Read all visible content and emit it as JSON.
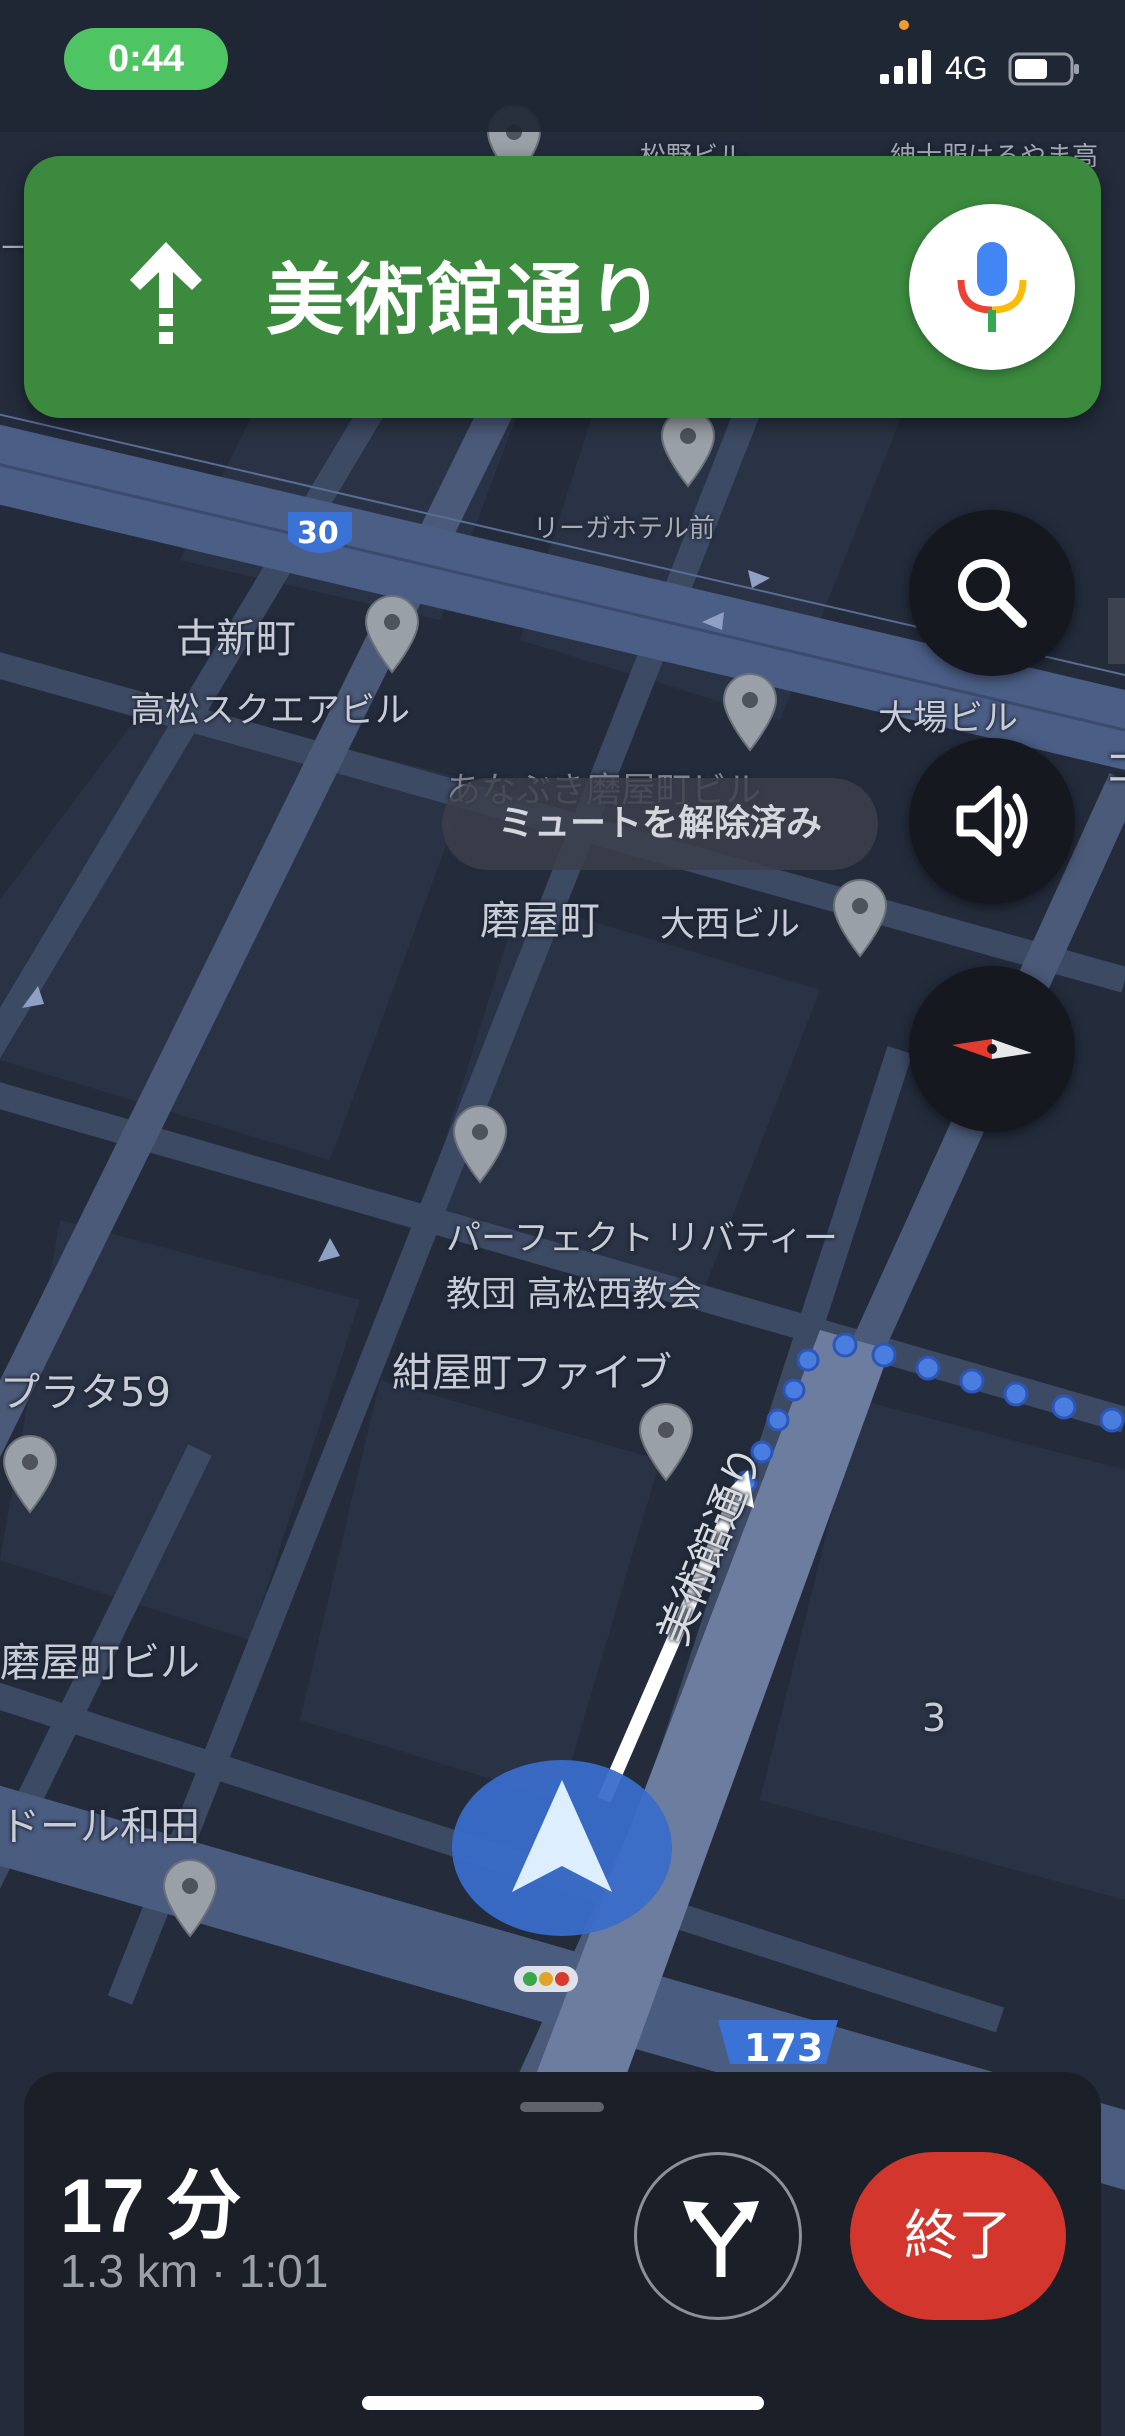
{
  "status_bar": {
    "time": "0:44",
    "network": "4G"
  },
  "navigation": {
    "street_name": "美術館通り",
    "maneuver_icon": "straight-arrow-icon"
  },
  "map": {
    "toast": "ミュートを解除済み",
    "route_shields": [
      "30",
      "173"
    ],
    "current_road_label": "美術館通り",
    "block_number": "3",
    "labels": {
      "top_left_partial": "ービ",
      "top_center_partial": "松野ビル",
      "top_right_partial": "紳士服はるやま高",
      "riga_hotel": "リーガホテル前",
      "kosin_machi": "古新町",
      "takamatsu_square": "高松スクエアビル",
      "oba_building": "大場ビル",
      "anabuki": "あなぶき磨屋町ビル",
      "togiya_machi": "磨屋町",
      "onishi_building": "大西ビル",
      "perfect_liberty_1": "パーフェクト リバティー",
      "perfect_liberty_2": "教団 高松西教会",
      "konya_five": "紺屋町ファイブ",
      "plaza59": "プラタ59",
      "togiya_building": "磨屋町ビル",
      "dor_wada": "ドール和田",
      "right_edge_partial": "コ"
    }
  },
  "controls": {
    "search": "search-icon",
    "sound": "volume-icon",
    "compass": "compass-icon"
  },
  "trip": {
    "duration": "17 分",
    "details": "1.3 km · 1:01",
    "end_label": "終了"
  },
  "colors": {
    "banner": "#3b8a3e",
    "route_dots": "#4a7de0",
    "end_button": "#d3362d",
    "time_pill": "#4ec562"
  }
}
